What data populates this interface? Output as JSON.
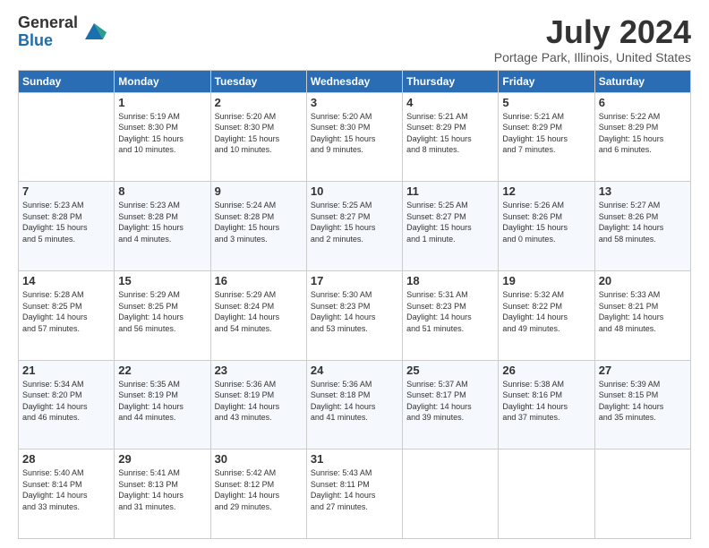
{
  "logo": {
    "general": "General",
    "blue": "Blue"
  },
  "title": "July 2024",
  "location": "Portage Park, Illinois, United States",
  "days": [
    "Sunday",
    "Monday",
    "Tuesday",
    "Wednesday",
    "Thursday",
    "Friday",
    "Saturday"
  ],
  "weeks": [
    [
      {
        "day": "",
        "info": ""
      },
      {
        "day": "1",
        "info": "Sunrise: 5:19 AM\nSunset: 8:30 PM\nDaylight: 15 hours\nand 10 minutes."
      },
      {
        "day": "2",
        "info": "Sunrise: 5:20 AM\nSunset: 8:30 PM\nDaylight: 15 hours\nand 10 minutes."
      },
      {
        "day": "3",
        "info": "Sunrise: 5:20 AM\nSunset: 8:30 PM\nDaylight: 15 hours\nand 9 minutes."
      },
      {
        "day": "4",
        "info": "Sunrise: 5:21 AM\nSunset: 8:29 PM\nDaylight: 15 hours\nand 8 minutes."
      },
      {
        "day": "5",
        "info": "Sunrise: 5:21 AM\nSunset: 8:29 PM\nDaylight: 15 hours\nand 7 minutes."
      },
      {
        "day": "6",
        "info": "Sunrise: 5:22 AM\nSunset: 8:29 PM\nDaylight: 15 hours\nand 6 minutes."
      }
    ],
    [
      {
        "day": "7",
        "info": "Sunrise: 5:23 AM\nSunset: 8:28 PM\nDaylight: 15 hours\nand 5 minutes."
      },
      {
        "day": "8",
        "info": "Sunrise: 5:23 AM\nSunset: 8:28 PM\nDaylight: 15 hours\nand 4 minutes."
      },
      {
        "day": "9",
        "info": "Sunrise: 5:24 AM\nSunset: 8:28 PM\nDaylight: 15 hours\nand 3 minutes."
      },
      {
        "day": "10",
        "info": "Sunrise: 5:25 AM\nSunset: 8:27 PM\nDaylight: 15 hours\nand 2 minutes."
      },
      {
        "day": "11",
        "info": "Sunrise: 5:25 AM\nSunset: 8:27 PM\nDaylight: 15 hours\nand 1 minute."
      },
      {
        "day": "12",
        "info": "Sunrise: 5:26 AM\nSunset: 8:26 PM\nDaylight: 15 hours\nand 0 minutes."
      },
      {
        "day": "13",
        "info": "Sunrise: 5:27 AM\nSunset: 8:26 PM\nDaylight: 14 hours\nand 58 minutes."
      }
    ],
    [
      {
        "day": "14",
        "info": "Sunrise: 5:28 AM\nSunset: 8:25 PM\nDaylight: 14 hours\nand 57 minutes."
      },
      {
        "day": "15",
        "info": "Sunrise: 5:29 AM\nSunset: 8:25 PM\nDaylight: 14 hours\nand 56 minutes."
      },
      {
        "day": "16",
        "info": "Sunrise: 5:29 AM\nSunset: 8:24 PM\nDaylight: 14 hours\nand 54 minutes."
      },
      {
        "day": "17",
        "info": "Sunrise: 5:30 AM\nSunset: 8:23 PM\nDaylight: 14 hours\nand 53 minutes."
      },
      {
        "day": "18",
        "info": "Sunrise: 5:31 AM\nSunset: 8:23 PM\nDaylight: 14 hours\nand 51 minutes."
      },
      {
        "day": "19",
        "info": "Sunrise: 5:32 AM\nSunset: 8:22 PM\nDaylight: 14 hours\nand 49 minutes."
      },
      {
        "day": "20",
        "info": "Sunrise: 5:33 AM\nSunset: 8:21 PM\nDaylight: 14 hours\nand 48 minutes."
      }
    ],
    [
      {
        "day": "21",
        "info": "Sunrise: 5:34 AM\nSunset: 8:20 PM\nDaylight: 14 hours\nand 46 minutes."
      },
      {
        "day": "22",
        "info": "Sunrise: 5:35 AM\nSunset: 8:19 PM\nDaylight: 14 hours\nand 44 minutes."
      },
      {
        "day": "23",
        "info": "Sunrise: 5:36 AM\nSunset: 8:19 PM\nDaylight: 14 hours\nand 43 minutes."
      },
      {
        "day": "24",
        "info": "Sunrise: 5:36 AM\nSunset: 8:18 PM\nDaylight: 14 hours\nand 41 minutes."
      },
      {
        "day": "25",
        "info": "Sunrise: 5:37 AM\nSunset: 8:17 PM\nDaylight: 14 hours\nand 39 minutes."
      },
      {
        "day": "26",
        "info": "Sunrise: 5:38 AM\nSunset: 8:16 PM\nDaylight: 14 hours\nand 37 minutes."
      },
      {
        "day": "27",
        "info": "Sunrise: 5:39 AM\nSunset: 8:15 PM\nDaylight: 14 hours\nand 35 minutes."
      }
    ],
    [
      {
        "day": "28",
        "info": "Sunrise: 5:40 AM\nSunset: 8:14 PM\nDaylight: 14 hours\nand 33 minutes."
      },
      {
        "day": "29",
        "info": "Sunrise: 5:41 AM\nSunset: 8:13 PM\nDaylight: 14 hours\nand 31 minutes."
      },
      {
        "day": "30",
        "info": "Sunrise: 5:42 AM\nSunset: 8:12 PM\nDaylight: 14 hours\nand 29 minutes."
      },
      {
        "day": "31",
        "info": "Sunrise: 5:43 AM\nSunset: 8:11 PM\nDaylight: 14 hours\nand 27 minutes."
      },
      {
        "day": "",
        "info": ""
      },
      {
        "day": "",
        "info": ""
      },
      {
        "day": "",
        "info": ""
      }
    ]
  ]
}
